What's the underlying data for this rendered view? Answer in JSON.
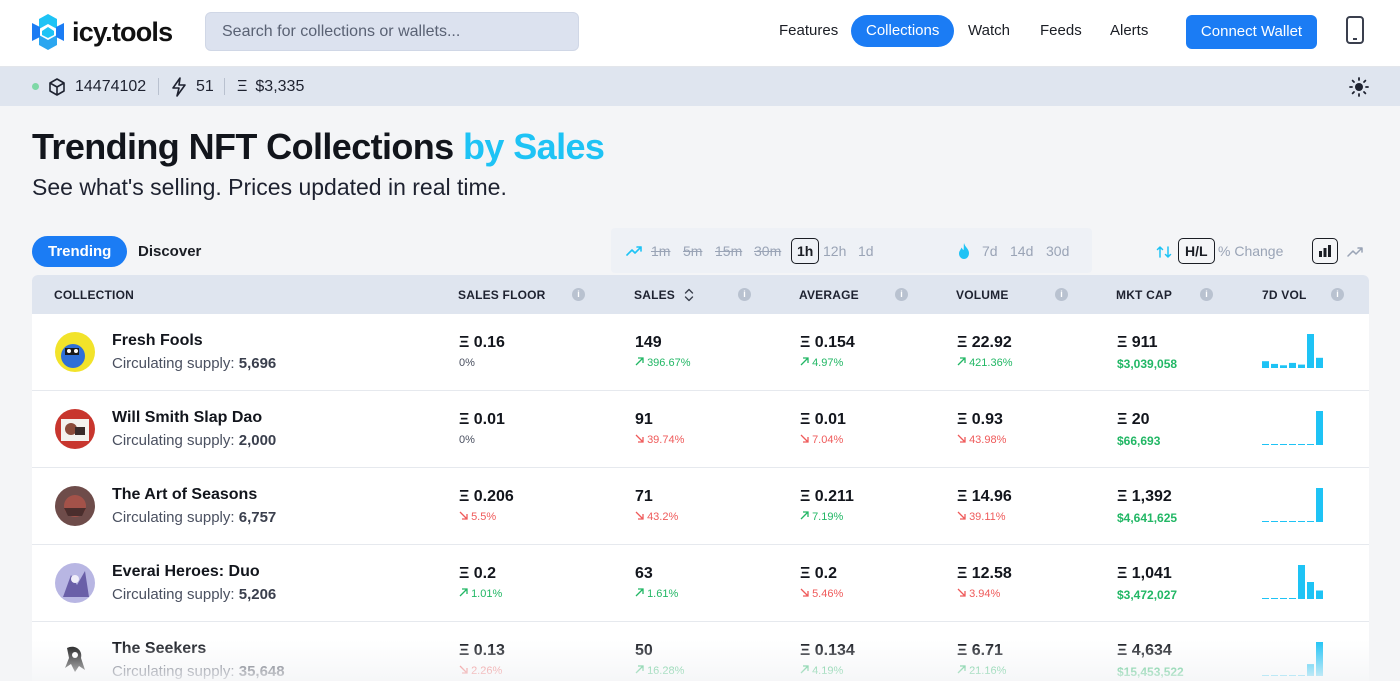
{
  "header": {
    "logo_text": "icy.tools",
    "search_placeholder": "Search for collections or wallets...",
    "nav": [
      {
        "label": "Features",
        "active": false
      },
      {
        "label": "Collections",
        "active": true
      },
      {
        "label": "Watch",
        "active": false
      },
      {
        "label": "Feeds",
        "active": false
      },
      {
        "label": "Alerts",
        "active": false
      }
    ],
    "connect_label": "Connect Wallet"
  },
  "status": {
    "block": "14474102",
    "gas": "51",
    "eth_price": "$3,335",
    "eth_symbol": "Ξ"
  },
  "page": {
    "title": "Trending NFT Collections",
    "title_accent": "by Sales",
    "subtitle": "See what's selling. Prices updated in real time."
  },
  "controls": {
    "tabs": [
      {
        "label": "Trending",
        "active": true
      },
      {
        "label": "Discover",
        "active": false
      }
    ],
    "timeframes_strike": [
      "1m",
      "5m",
      "15m",
      "30m"
    ],
    "timeframe_selected": "1h",
    "timeframes_other": [
      "12h",
      "1d"
    ],
    "ranges": [
      "7d",
      "14d",
      "30d"
    ],
    "hl_label": "H/L",
    "pct_label": "% Change"
  },
  "table": {
    "columns": [
      "COLLECTION",
      "SALES FLOOR",
      "SALES",
      "AVERAGE",
      "VOLUME",
      "MKT CAP",
      "7D VOL"
    ],
    "supply_prefix": "Circulating supply:",
    "rows": [
      {
        "name": "Fresh Fools",
        "supply": "5,696",
        "floor": "Ξ 0.16",
        "floor_chg": "0%",
        "floor_dir": "flat",
        "sales": "149",
        "sales_chg": "396.67%",
        "sales_dir": "up",
        "avg": "Ξ 0.154",
        "avg_chg": "4.97%",
        "avg_dir": "up",
        "volume": "Ξ 22.92",
        "volume_chg": "421.36%",
        "volume_dir": "up",
        "mcap": "Ξ 911",
        "mcap_usd": "$3,039,058",
        "vol7d": [
          0.2,
          0.12,
          0.08,
          0.15,
          0.1,
          1.0,
          0.3
        ]
      },
      {
        "name": "Will Smith Slap Dao",
        "supply": "2,000",
        "floor": "Ξ 0.01",
        "floor_chg": "0%",
        "floor_dir": "flat",
        "sales": "91",
        "sales_chg": "39.74%",
        "sales_dir": "down",
        "avg": "Ξ 0.01",
        "avg_chg": "7.04%",
        "avg_dir": "down",
        "volume": "Ξ 0.93",
        "volume_chg": "43.98%",
        "volume_dir": "down",
        "mcap": "Ξ 20",
        "mcap_usd": "$66,693",
        "vol7d": [
          0.02,
          0.02,
          0.02,
          0.02,
          0.02,
          0.02,
          1.0
        ]
      },
      {
        "name": "The Art of Seasons",
        "supply": "6,757",
        "floor": "Ξ 0.206",
        "floor_chg": "5.5%",
        "floor_dir": "down",
        "sales": "71",
        "sales_chg": "43.2%",
        "sales_dir": "down",
        "avg": "Ξ 0.211",
        "avg_chg": "7.19%",
        "avg_dir": "up",
        "volume": "Ξ 14.96",
        "volume_chg": "39.11%",
        "volume_dir": "down",
        "mcap": "Ξ 1,392",
        "mcap_usd": "$4,641,625",
        "vol7d": [
          0.02,
          0.02,
          0.02,
          0.02,
          0.02,
          0.02,
          1.0
        ]
      },
      {
        "name": "Everai Heroes: Duo",
        "supply": "5,206",
        "floor": "Ξ 0.2",
        "floor_chg": "1.01%",
        "floor_dir": "up",
        "sales": "63",
        "sales_chg": "1.61%",
        "sales_dir": "up",
        "avg": "Ξ 0.2",
        "avg_chg": "5.46%",
        "avg_dir": "down",
        "volume": "Ξ 12.58",
        "volume_chg": "3.94%",
        "volume_dir": "down",
        "mcap": "Ξ 1,041",
        "mcap_usd": "$3,472,027",
        "vol7d": [
          0.02,
          0.02,
          0.02,
          0.02,
          1.0,
          0.5,
          0.25
        ]
      },
      {
        "name": "The Seekers",
        "supply": "35,648",
        "floor": "Ξ 0.13",
        "floor_chg": "2.26%",
        "floor_dir": "down",
        "sales": "50",
        "sales_chg": "16.28%",
        "sales_dir": "up",
        "avg": "Ξ 0.134",
        "avg_chg": "4.19%",
        "avg_dir": "up",
        "volume": "Ξ 6.71",
        "volume_chg": "21.16%",
        "volume_dir": "up",
        "mcap": "Ξ 4,634",
        "mcap_usd": "$15,453,522",
        "vol7d": [
          0.02,
          0.02,
          0.02,
          0.02,
          0.02,
          0.35,
          1.0
        ]
      }
    ]
  },
  "colors": {
    "accent": "#1b7cf4",
    "cyan": "#1ec3f5",
    "up": "#22b765",
    "down": "#ef5a5a"
  }
}
